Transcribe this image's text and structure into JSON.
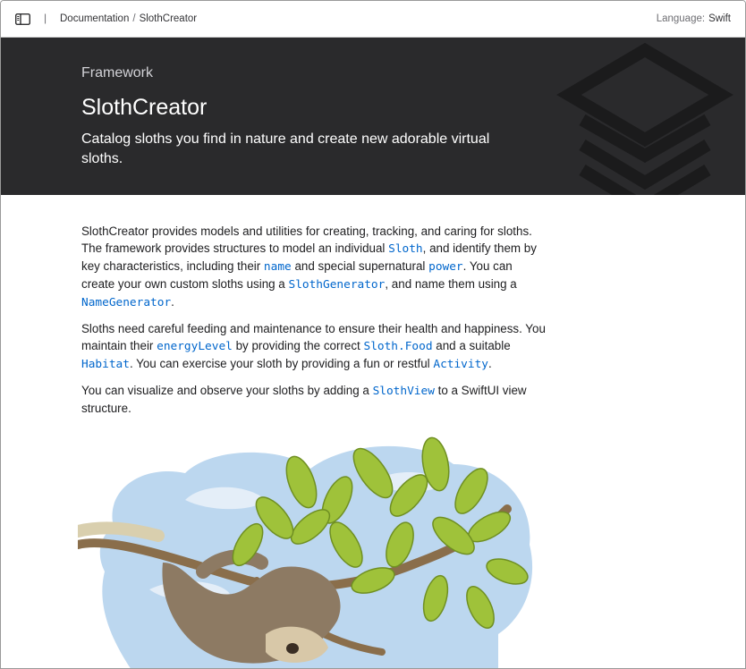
{
  "nav": {
    "breadcrumb": [
      "Documentation",
      "SlothCreator"
    ],
    "separator": "|",
    "slash": "/",
    "language_label": "Language:",
    "language_value": "Swift"
  },
  "hero": {
    "eyebrow": "Framework",
    "title": "SlothCreator",
    "abstract": "Catalog sloths you find in nature and create new adorable virtual sloths."
  },
  "body": {
    "p1": {
      "t1": "SlothCreator provides models and utilities for creating, tracking, and caring for sloths. The framework provides structures to model an individual ",
      "sym1": "Sloth",
      "t2": ", and identify them by key characteristics, including their ",
      "sym2": "name",
      "t3": " and special supernatural ",
      "sym3": "power",
      "t4": ". You can create your own custom sloths using a ",
      "sym4": "SlothGenerator",
      "t5": ", and name them using a ",
      "sym5": "NameGenerator",
      "t6": "."
    },
    "p2": {
      "t1": "Sloths need careful feeding and maintenance to ensure their health and happiness. You maintain their ",
      "sym1": "energyLevel",
      "t2": " by providing the correct ",
      "sym2": "Sloth.Food",
      "t3": " and a suitable ",
      "sym3": "Habitat",
      "t4": ". You can exercise your sloth by providing a fun or restful ",
      "sym4": "Activity",
      "t5": "."
    },
    "p3": {
      "t1": "You can visualize and observe your sloths by adding a ",
      "sym1": "SlothView",
      "t2": " to a SwiftUI view structure."
    }
  },
  "colors": {
    "hero_bg": "#2a2a2c",
    "link": "#0066cc",
    "leaf": "#9fc23a",
    "sky": "#bcd7ef"
  },
  "icons": [
    "sidebar-toggle-icon",
    "framework-layers-icon"
  ]
}
